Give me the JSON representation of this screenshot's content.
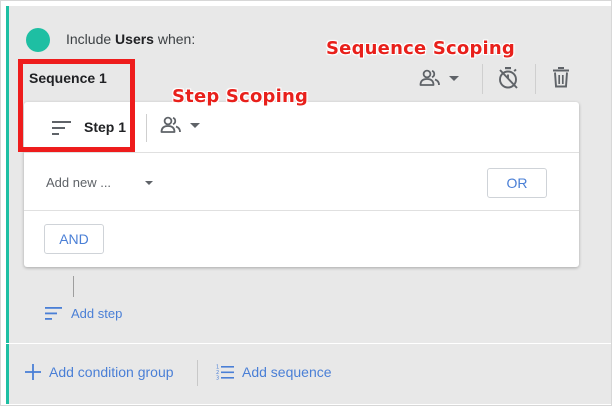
{
  "header": {
    "prefix": "Include ",
    "entity": "Users",
    "suffix": " when:"
  },
  "annotations": {
    "sequence_scoping": "Sequence Scoping",
    "step_scoping": "Step Scoping"
  },
  "sequence": {
    "title": "Sequence 1",
    "icons": [
      "users-scope-icon",
      "caret-down-icon",
      "timer-off-icon",
      "trash-icon"
    ]
  },
  "step": {
    "label": "Step 1",
    "icons": [
      "sort-lines-icon",
      "users-scope-icon",
      "caret-down-icon"
    ]
  },
  "condition": {
    "placeholder": "Add new ...",
    "or_label": "OR",
    "and_label": "AND"
  },
  "actions": {
    "add_step": "Add step",
    "add_condition_group": "Add condition group",
    "add_sequence": "Add sequence"
  },
  "colors": {
    "accent_teal": "#1ebfa3",
    "link_blue": "#4a7fd6",
    "annotation_red": "#e8201b"
  }
}
